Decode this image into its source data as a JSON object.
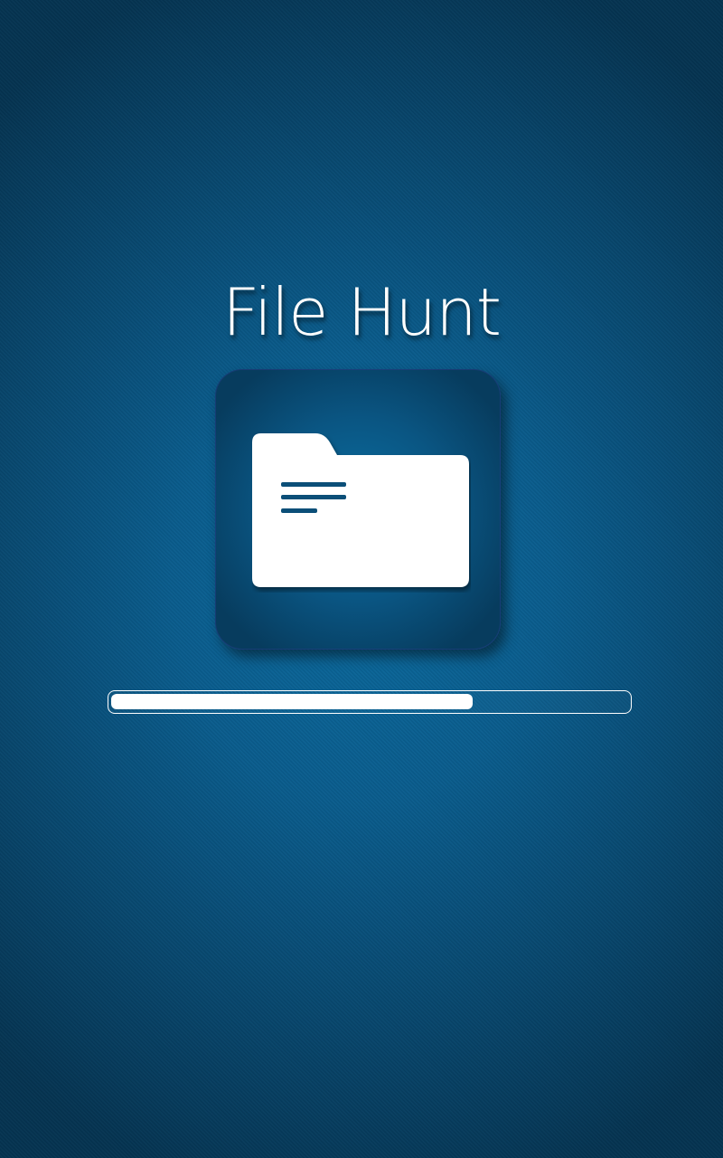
{
  "app": {
    "title": "File Hunt"
  },
  "splash": {
    "icon": "folder-document-icon",
    "progress_percent": 70
  },
  "colors": {
    "background": "#0a5d8e",
    "background_edge": "#053452",
    "icon_tile": "#0a5582",
    "foreground": "#ffffff"
  }
}
